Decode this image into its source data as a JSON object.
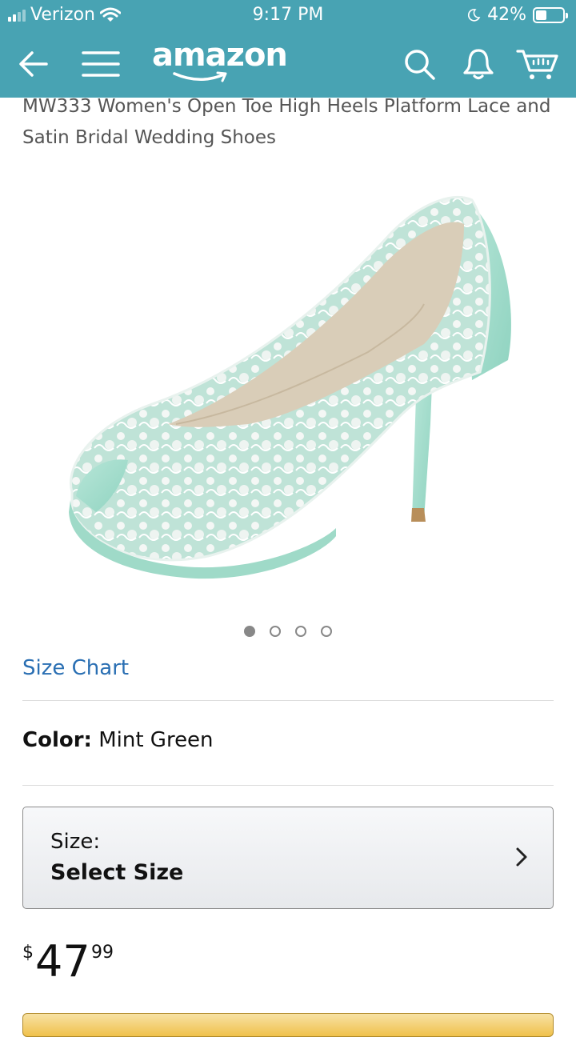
{
  "status_bar": {
    "carrier": "Verizon",
    "time": "9:17 PM",
    "battery": "42%",
    "battery_level": 0.42
  },
  "header": {
    "logo_text": "amazon",
    "icons": [
      "back-arrow-icon",
      "hamburger-menu-icon",
      "search-icon",
      "bell-icon",
      "cart-icon"
    ]
  },
  "product": {
    "title": "MW333 Women's Open Toe High Heels Platform Lace and Satin Bridal Wedding Shoes",
    "image_count": 4,
    "active_image": 1
  },
  "size_chart_link": "Size Chart",
  "color": {
    "label": "Color:",
    "value": "Mint Green"
  },
  "size_selector": {
    "label": "Size:",
    "value": "Select Size"
  },
  "price": {
    "currency": "$",
    "whole": "47",
    "fraction": "99"
  },
  "colors": {
    "header_bg": "#48a3b3",
    "link": "#2a6fb3",
    "buy_button": "#f0c14b"
  }
}
